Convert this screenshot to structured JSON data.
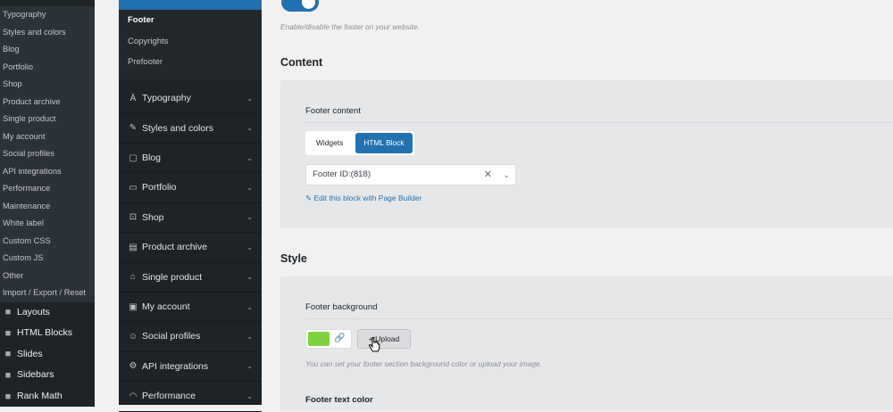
{
  "wp_menu": {
    "sub_items": [
      "Typography",
      "Styles and colors",
      "Blog",
      "Portfolio",
      "Shop",
      "Product archive",
      "Single product",
      "My account",
      "Social profiles",
      "API integrations",
      "Performance",
      "Maintenance",
      "White label",
      "Custom CSS",
      "Custom JS",
      "Other",
      "Import / Export / Reset"
    ],
    "main_items": [
      {
        "label": "Layouts",
        "icon": "layers-icon"
      },
      {
        "label": "HTML Blocks",
        "icon": "blocks-icon"
      },
      {
        "label": "Slides",
        "icon": "slides-icon"
      },
      {
        "label": "Sidebars",
        "icon": "sidebars-icon"
      },
      {
        "label": "Rank Math",
        "icon": "rank-math-icon"
      }
    ]
  },
  "options_panel": {
    "subsections": [
      {
        "label": "Footer",
        "active": true
      },
      {
        "label": "Copyrights",
        "active": false
      },
      {
        "label": "Prefooter",
        "active": false
      }
    ],
    "sections": [
      {
        "label": "Typography",
        "icon": "typography-icon",
        "glyph": "Ä"
      },
      {
        "label": "Styles and colors",
        "icon": "brush-icon",
        "glyph": "✎"
      },
      {
        "label": "Blog",
        "icon": "blog-icon",
        "glyph": "▢"
      },
      {
        "label": "Portfolio",
        "icon": "portfolio-icon",
        "glyph": "▭"
      },
      {
        "label": "Shop",
        "icon": "cart-icon",
        "glyph": "⊡"
      },
      {
        "label": "Product archive",
        "icon": "archive-icon",
        "glyph": "▤"
      },
      {
        "label": "Single product",
        "icon": "bag-icon",
        "glyph": "⌂"
      },
      {
        "label": "My account",
        "icon": "account-icon",
        "glyph": "▣"
      },
      {
        "label": "Social profiles",
        "icon": "users-icon",
        "glyph": "☺"
      },
      {
        "label": "API integrations",
        "icon": "gear-icon",
        "glyph": "⚙"
      },
      {
        "label": "Performance",
        "icon": "gauge-icon",
        "glyph": "◠"
      }
    ]
  },
  "main": {
    "enable_hint": "Enable/disable the footer on your website.",
    "content": {
      "title": "Content",
      "footer_content_label": "Footer content",
      "tabs": [
        {
          "label": "Widgets",
          "active": false
        },
        {
          "label": "HTML Block",
          "active": true
        }
      ],
      "select_value": "Footer ID:(818)",
      "edit_link": "Edit this block with Page Builder"
    },
    "style": {
      "title": "Style",
      "footer_background_label": "Footer background",
      "color": "#7ed23d",
      "upload_label": "Upload",
      "background_hint": "You can set your footer section background color or upload your image.",
      "footer_text_color_label": "Footer text color"
    }
  },
  "colors": {
    "accent": "#2271b1",
    "sidebar_dark": "#1d2327"
  }
}
